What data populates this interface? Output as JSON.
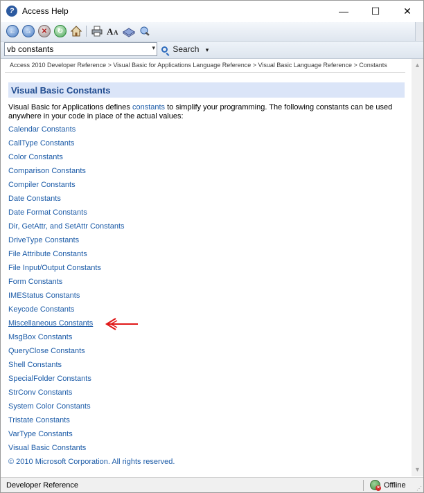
{
  "window": {
    "title": "Access Help",
    "minimize": "—",
    "maximize": "☐",
    "close": "✕"
  },
  "toolbar": {
    "icons": [
      "back-icon",
      "forward-icon",
      "stop-icon",
      "refresh-icon",
      "home-icon",
      "print-icon",
      "font-size-icon",
      "toc-book-icon",
      "keep-on-top-icon"
    ],
    "back": "←",
    "forward": "→",
    "stop": "✕",
    "refresh": "↻"
  },
  "search": {
    "value": "vb constants",
    "button_label": "Search",
    "dropdown": "▾",
    "options_arrow": "▾"
  },
  "breadcrumb": "Access 2010 Developer Reference > Visual Basic for Applications Language Reference > Visual Basic Language Reference > Constants",
  "article": {
    "title": "Visual Basic Constants",
    "intro_before": "Visual Basic for Applications defines ",
    "intro_link": "constants",
    "intro_after": " to simplify your programming. The following constants can be used anywhere in your code in place of the actual values:",
    "links": [
      "Calendar Constants",
      "CallType Constants",
      "Color Constants",
      "Comparison Constants",
      "Compiler Constants",
      "Date Constants",
      "Date Format Constants",
      "Dir, GetAttr, and SetAttr Constants",
      "DriveType Constants",
      "File Attribute Constants",
      "File Input/Output Constants",
      "Form Constants",
      "IMEStatus Constants",
      "Keycode Constants",
      "Miscellaneous Constants",
      "MsgBox Constants",
      "QueryClose Constants",
      "Shell Constants",
      "SpecialFolder Constants",
      "StrConv Constants",
      "System Color Constants",
      "Tristate Constants",
      "VarType Constants",
      "Visual Basic Constants"
    ],
    "highlighted_link": "Miscellaneous Constants",
    "copyright": "© 2010 Microsoft Corporation. All rights reserved."
  },
  "colors": {
    "link": "#1a5aa7",
    "heading_band": "#dbe5f8",
    "heading_text": "#1f4b8f",
    "annotation_arrow": "#e01818"
  },
  "statusbar": {
    "left": "Developer Reference",
    "right": "Offline"
  }
}
